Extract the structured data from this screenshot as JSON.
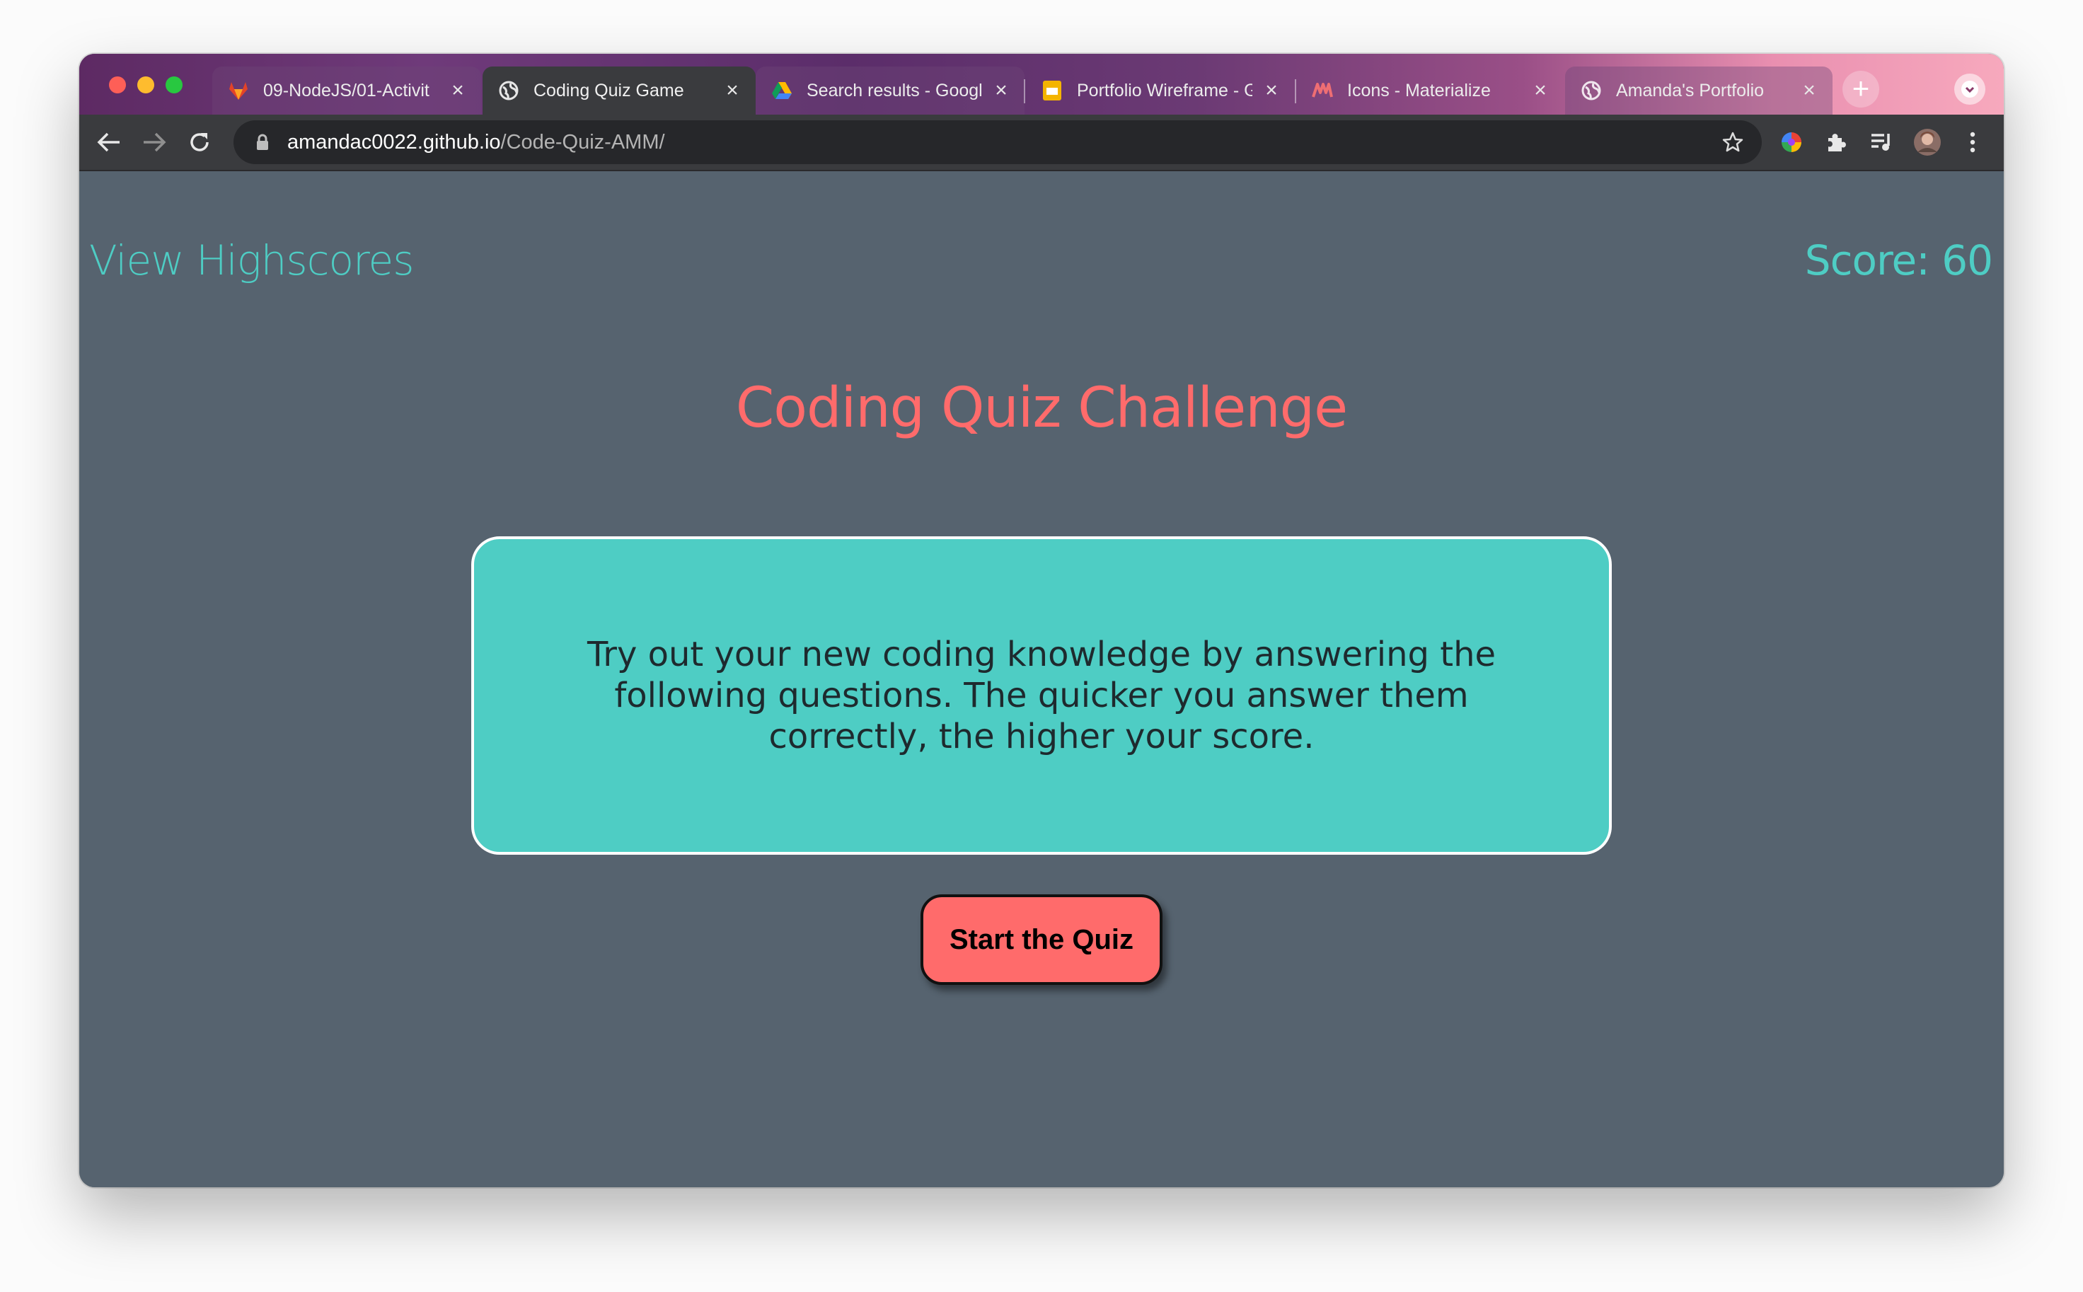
{
  "browser": {
    "tabs": [
      {
        "title": "09-NodeJS/01-Activit",
        "icon": "gitlab-icon",
        "active": false
      },
      {
        "title": "Coding Quiz Game",
        "icon": "globe-icon",
        "active": true
      },
      {
        "title": "Search results - Googl",
        "icon": "google-drive-icon",
        "active": false
      },
      {
        "title": "Portfolio Wireframe - G",
        "icon": "google-slides-icon",
        "active": false
      },
      {
        "title": "Icons - Materialize",
        "icon": "materialize-icon",
        "active": false
      },
      {
        "title": "Amanda's Portfolio",
        "icon": "globe-icon",
        "active": false
      }
    ],
    "url_host": "amandac0022.github.io",
    "url_path": "/Code-Quiz-AMM/"
  },
  "page": {
    "highscores_link": "View Highscores",
    "score_text": "Score: 60",
    "title": "Coding Quiz Challenge",
    "intro": "Try out your new coding knowledge by answering the following questions. The quicker you answer them correctly, the higher your score.",
    "start_button": "Start the Quiz"
  },
  "colors": {
    "accent_teal": "#4ecdc4",
    "accent_coral": "#ff6b6b",
    "page_background": "#56636f"
  }
}
